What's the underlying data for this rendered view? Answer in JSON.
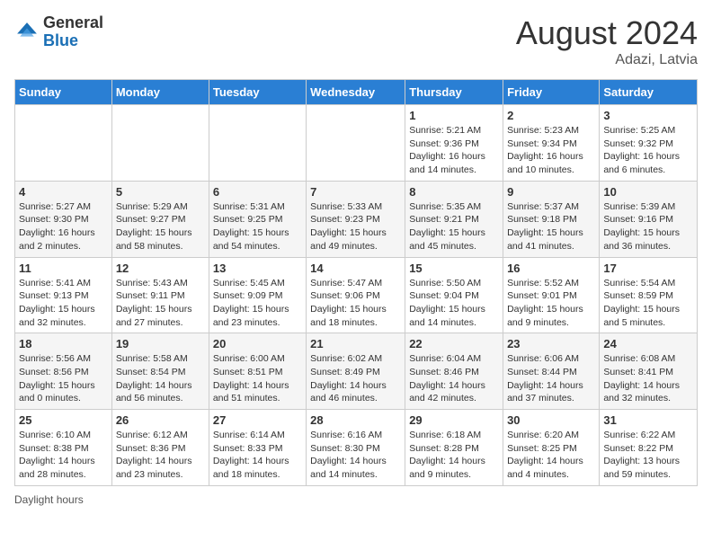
{
  "header": {
    "logo_general": "General",
    "logo_blue": "Blue",
    "month_title": "August 2024",
    "location": "Adazi, Latvia"
  },
  "days_of_week": [
    "Sunday",
    "Monday",
    "Tuesday",
    "Wednesday",
    "Thursday",
    "Friday",
    "Saturday"
  ],
  "footer": {
    "daylight_label": "Daylight hours"
  },
  "weeks": [
    [
      {
        "day": "",
        "sunrise": "",
        "sunset": "",
        "daylight": ""
      },
      {
        "day": "",
        "sunrise": "",
        "sunset": "",
        "daylight": ""
      },
      {
        "day": "",
        "sunrise": "",
        "sunset": "",
        "daylight": ""
      },
      {
        "day": "",
        "sunrise": "",
        "sunset": "",
        "daylight": ""
      },
      {
        "day": "1",
        "sunrise": "5:21 AM",
        "sunset": "9:36 PM",
        "daylight": "16 hours and 14 minutes."
      },
      {
        "day": "2",
        "sunrise": "5:23 AM",
        "sunset": "9:34 PM",
        "daylight": "16 hours and 10 minutes."
      },
      {
        "day": "3",
        "sunrise": "5:25 AM",
        "sunset": "9:32 PM",
        "daylight": "16 hours and 6 minutes."
      }
    ],
    [
      {
        "day": "4",
        "sunrise": "5:27 AM",
        "sunset": "9:30 PM",
        "daylight": "16 hours and 2 minutes."
      },
      {
        "day": "5",
        "sunrise": "5:29 AM",
        "sunset": "9:27 PM",
        "daylight": "15 hours and 58 minutes."
      },
      {
        "day": "6",
        "sunrise": "5:31 AM",
        "sunset": "9:25 PM",
        "daylight": "15 hours and 54 minutes."
      },
      {
        "day": "7",
        "sunrise": "5:33 AM",
        "sunset": "9:23 PM",
        "daylight": "15 hours and 49 minutes."
      },
      {
        "day": "8",
        "sunrise": "5:35 AM",
        "sunset": "9:21 PM",
        "daylight": "15 hours and 45 minutes."
      },
      {
        "day": "9",
        "sunrise": "5:37 AM",
        "sunset": "9:18 PM",
        "daylight": "15 hours and 41 minutes."
      },
      {
        "day": "10",
        "sunrise": "5:39 AM",
        "sunset": "9:16 PM",
        "daylight": "15 hours and 36 minutes."
      }
    ],
    [
      {
        "day": "11",
        "sunrise": "5:41 AM",
        "sunset": "9:13 PM",
        "daylight": "15 hours and 32 minutes."
      },
      {
        "day": "12",
        "sunrise": "5:43 AM",
        "sunset": "9:11 PM",
        "daylight": "15 hours and 27 minutes."
      },
      {
        "day": "13",
        "sunrise": "5:45 AM",
        "sunset": "9:09 PM",
        "daylight": "15 hours and 23 minutes."
      },
      {
        "day": "14",
        "sunrise": "5:47 AM",
        "sunset": "9:06 PM",
        "daylight": "15 hours and 18 minutes."
      },
      {
        "day": "15",
        "sunrise": "5:50 AM",
        "sunset": "9:04 PM",
        "daylight": "15 hours and 14 minutes."
      },
      {
        "day": "16",
        "sunrise": "5:52 AM",
        "sunset": "9:01 PM",
        "daylight": "15 hours and 9 minutes."
      },
      {
        "day": "17",
        "sunrise": "5:54 AM",
        "sunset": "8:59 PM",
        "daylight": "15 hours and 5 minutes."
      }
    ],
    [
      {
        "day": "18",
        "sunrise": "5:56 AM",
        "sunset": "8:56 PM",
        "daylight": "15 hours and 0 minutes."
      },
      {
        "day": "19",
        "sunrise": "5:58 AM",
        "sunset": "8:54 PM",
        "daylight": "14 hours and 56 minutes."
      },
      {
        "day": "20",
        "sunrise": "6:00 AM",
        "sunset": "8:51 PM",
        "daylight": "14 hours and 51 minutes."
      },
      {
        "day": "21",
        "sunrise": "6:02 AM",
        "sunset": "8:49 PM",
        "daylight": "14 hours and 46 minutes."
      },
      {
        "day": "22",
        "sunrise": "6:04 AM",
        "sunset": "8:46 PM",
        "daylight": "14 hours and 42 minutes."
      },
      {
        "day": "23",
        "sunrise": "6:06 AM",
        "sunset": "8:44 PM",
        "daylight": "14 hours and 37 minutes."
      },
      {
        "day": "24",
        "sunrise": "6:08 AM",
        "sunset": "8:41 PM",
        "daylight": "14 hours and 32 minutes."
      }
    ],
    [
      {
        "day": "25",
        "sunrise": "6:10 AM",
        "sunset": "8:38 PM",
        "daylight": "14 hours and 28 minutes."
      },
      {
        "day": "26",
        "sunrise": "6:12 AM",
        "sunset": "8:36 PM",
        "daylight": "14 hours and 23 minutes."
      },
      {
        "day": "27",
        "sunrise": "6:14 AM",
        "sunset": "8:33 PM",
        "daylight": "14 hours and 18 minutes."
      },
      {
        "day": "28",
        "sunrise": "6:16 AM",
        "sunset": "8:30 PM",
        "daylight": "14 hours and 14 minutes."
      },
      {
        "day": "29",
        "sunrise": "6:18 AM",
        "sunset": "8:28 PM",
        "daylight": "14 hours and 9 minutes."
      },
      {
        "day": "30",
        "sunrise": "6:20 AM",
        "sunset": "8:25 PM",
        "daylight": "14 hours and 4 minutes."
      },
      {
        "day": "31",
        "sunrise": "6:22 AM",
        "sunset": "8:22 PM",
        "daylight": "13 hours and 59 minutes."
      }
    ]
  ]
}
